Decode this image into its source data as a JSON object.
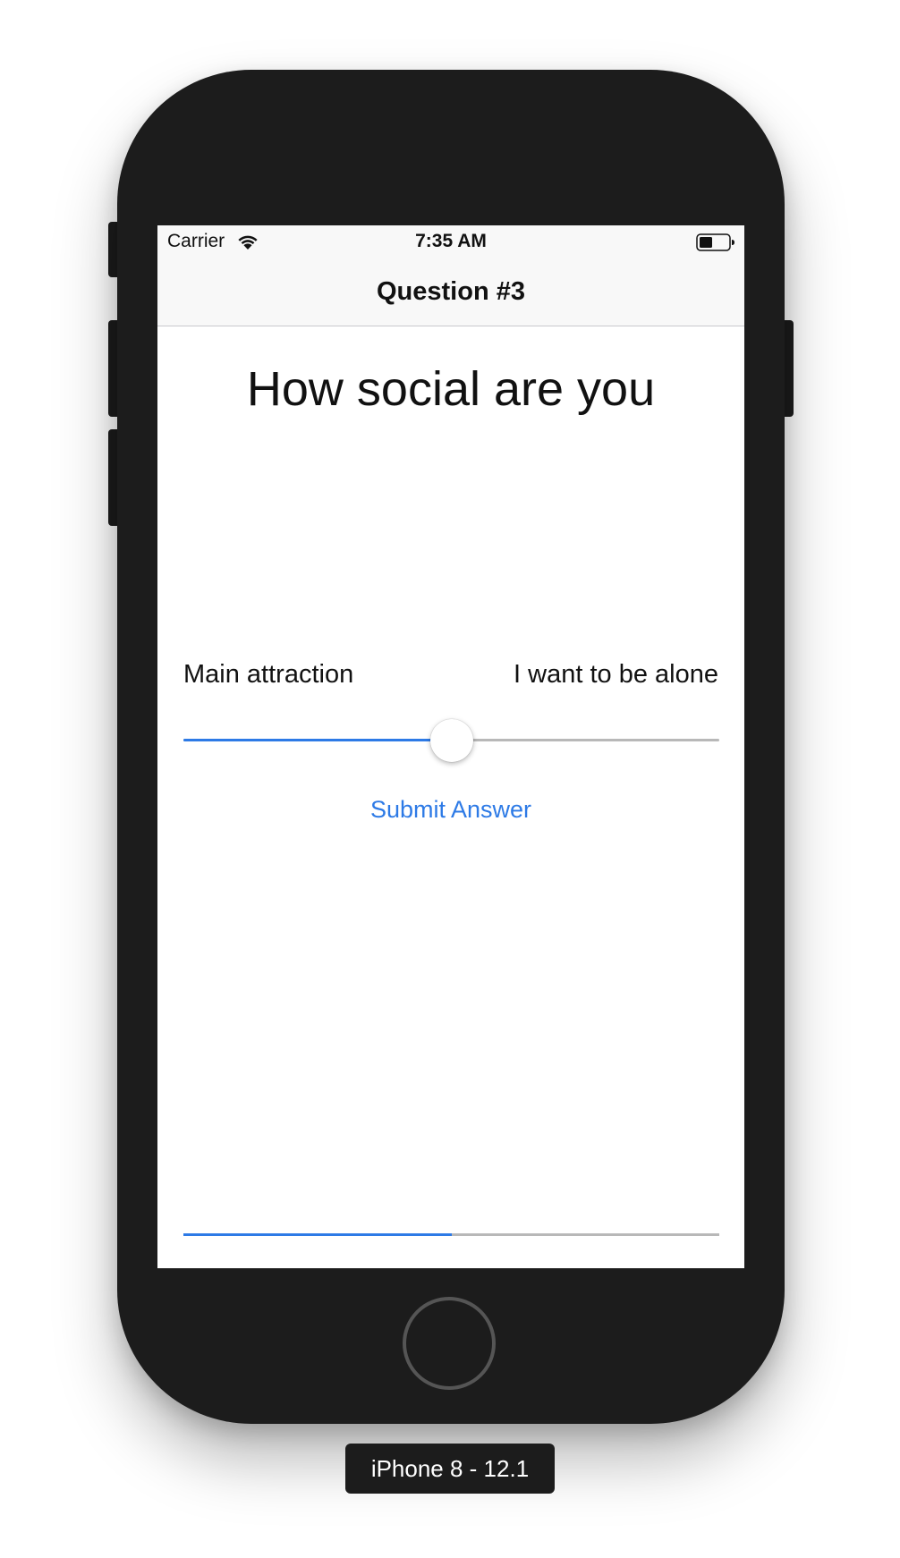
{
  "status_bar": {
    "carrier": "Carrier",
    "time": "7:35 AM",
    "icons": [
      "wifi-icon",
      "battery-icon"
    ]
  },
  "nav": {
    "title": "Question #3"
  },
  "question": {
    "text": "How social are you",
    "left_label": "Main attraction",
    "right_label": "I want to be alone",
    "slider_value": 0.5
  },
  "submit": {
    "label": "Submit Answer"
  },
  "progress": {
    "value": 0.5
  },
  "device": {
    "label": "iPhone 8 - 12.1"
  },
  "colors": {
    "accent": "#2d7ae6",
    "track": "#b8b8b8",
    "bezel": "#1c1c1c"
  }
}
